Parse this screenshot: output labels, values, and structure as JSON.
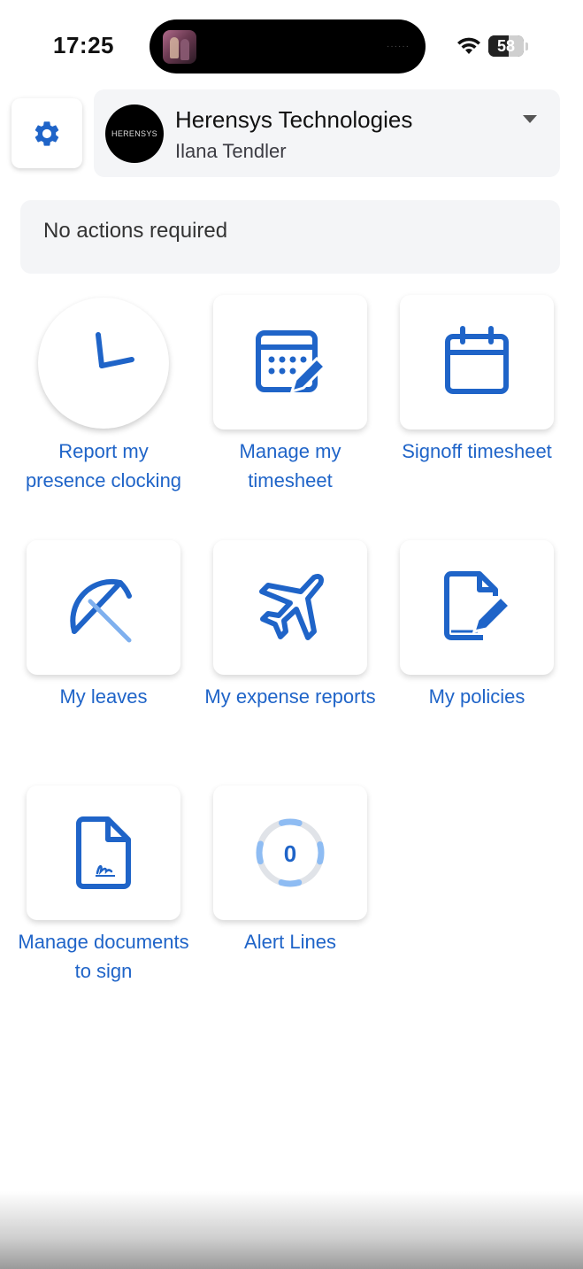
{
  "status_bar": {
    "time": "17:25",
    "battery_level": "58",
    "battery_fraction": 0.58,
    "icons": [
      "wifi-icon",
      "battery-icon"
    ]
  },
  "header": {
    "settings_icon": "gear-icon",
    "company_name": "Herensys Technologies",
    "logo_text": "HERENSYS",
    "user_name": "Ilana Tendler",
    "dropdown_icon": "caret-down-icon"
  },
  "actions": {
    "message": "No actions required"
  },
  "tiles": [
    {
      "label": "Report my presence clocking",
      "icon": "clock-icon"
    },
    {
      "label": "Manage my timesheet",
      "icon": "calendar-edit-icon"
    },
    {
      "label": "Signoff timesheet",
      "icon": "calendar-icon"
    },
    {
      "label": "My leaves",
      "icon": "umbrella-icon"
    },
    {
      "label": "My expense reports",
      "icon": "airplane-icon"
    },
    {
      "label": "My policies",
      "icon": "document-edit-icon"
    },
    {
      "label": "Manage documents to sign",
      "icon": "document-signature-icon"
    },
    {
      "label": "Alert Lines",
      "icon": "progress-ring-icon",
      "count": "0"
    }
  ],
  "colors": {
    "accent": "#1f64c8",
    "panel_background": "#f4f5f7"
  }
}
